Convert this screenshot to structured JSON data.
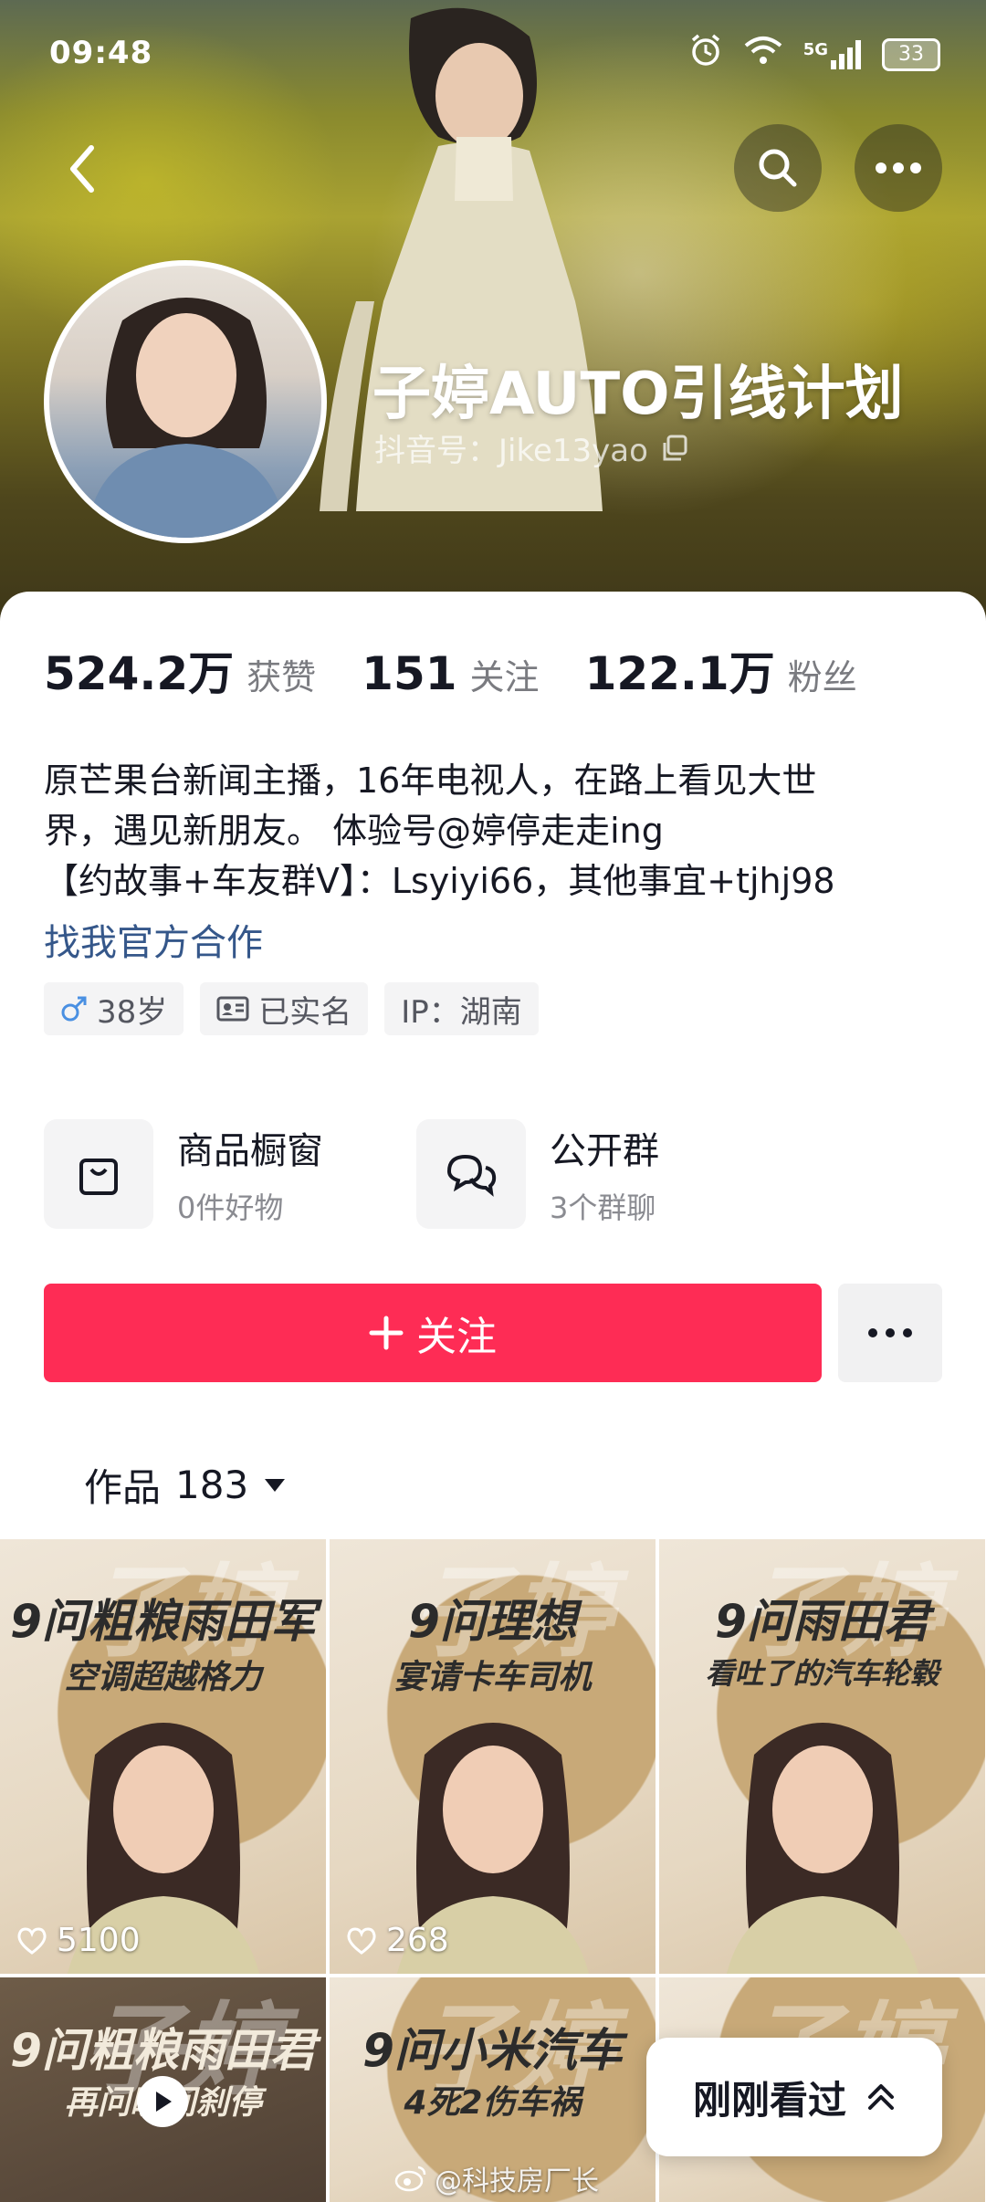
{
  "status_bar": {
    "time": "09:48",
    "network": "5G",
    "battery": "33"
  },
  "profile": {
    "name": "子婷AUTO引线计划",
    "id_label": "抖音号：Jike13yao"
  },
  "stats": [
    {
      "value": "524.2万",
      "label": "获赞"
    },
    {
      "value": "151",
      "label": "关注"
    },
    {
      "value": "122.1万",
      "label": "粉丝"
    }
  ],
  "bio": {
    "lines": [
      "原芒果台新闻主播，16年电视人，在路上看见大世",
      "界，遇见新朋友。 体验号@婷停走走ing",
      "【约故事+车友群V】：Lsyiyi66，其他事宜+tjhj98"
    ],
    "link": "找我官方合作"
  },
  "tags": [
    {
      "icon": "male-icon",
      "text": "38岁"
    },
    {
      "icon": "id-card-icon",
      "text": "已实名"
    },
    {
      "icon": "",
      "text": "IP：湖南"
    }
  ],
  "features": [
    {
      "icon": "shopping-bag-icon",
      "title": "商品橱窗",
      "sub": "0件好物"
    },
    {
      "icon": "group-chat-icon",
      "title": "公开群",
      "sub": "3个群聊"
    }
  ],
  "actions": {
    "follow_label": "关注"
  },
  "works_tab": {
    "label": "作品",
    "count": "183"
  },
  "videos": [
    {
      "title": "9问粗粮雨田军",
      "subtitle": "空调超越格力",
      "likes": "5100"
    },
    {
      "title": "9问理想",
      "subtitle": "宴请卡车司机",
      "likes": "268"
    },
    {
      "title": "9问雨田君",
      "subtitle": "看吐了的汽车轮毂",
      "likes": ""
    },
    {
      "title": "9问粗粮雨田君",
      "subtitle": "再问瞬间刹停",
      "likes": ""
    },
    {
      "title": "9问小米汽车",
      "subtitle": "4死2伤车祸",
      "likes": ""
    },
    {
      "title": "",
      "subtitle": "",
      "likes": ""
    }
  ],
  "watermark_text": "子婷",
  "recent": {
    "label": "刚刚看过"
  },
  "weibo_watermark": "@科技房厂长",
  "colors": {
    "follow_red": "#fe2c55",
    "link_blue": "#35578a"
  }
}
